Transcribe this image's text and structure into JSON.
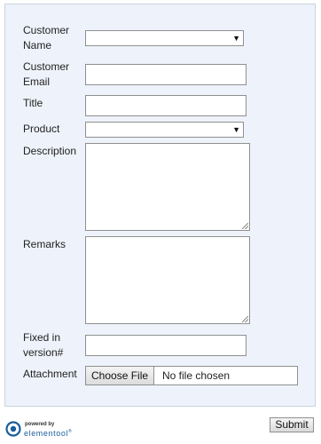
{
  "form": {
    "fields": {
      "customer_name": {
        "label": "Customer Name",
        "value": ""
      },
      "customer_email": {
        "label": "Customer Email",
        "value": ""
      },
      "title": {
        "label": "Title",
        "value": ""
      },
      "product": {
        "label": "Product",
        "value": ""
      },
      "description": {
        "label": "Description",
        "value": ""
      },
      "remarks": {
        "label": "Remarks",
        "value": ""
      },
      "fixed_in_version": {
        "label": "Fixed in version#",
        "value": ""
      },
      "attachment": {
        "label": "Attachment",
        "button_label": "Choose File",
        "status": "No file chosen"
      }
    },
    "dropdown_icon": "dropdown-arrow",
    "submit_label": "Submit"
  },
  "footer": {
    "powered_by": "powered by",
    "brand": "elementool",
    "brand_mark": "®",
    "logo_color": "#1a5d9c"
  },
  "colors": {
    "panel_background": "#eef3fb",
    "panel_border": "#c9d3e0"
  }
}
